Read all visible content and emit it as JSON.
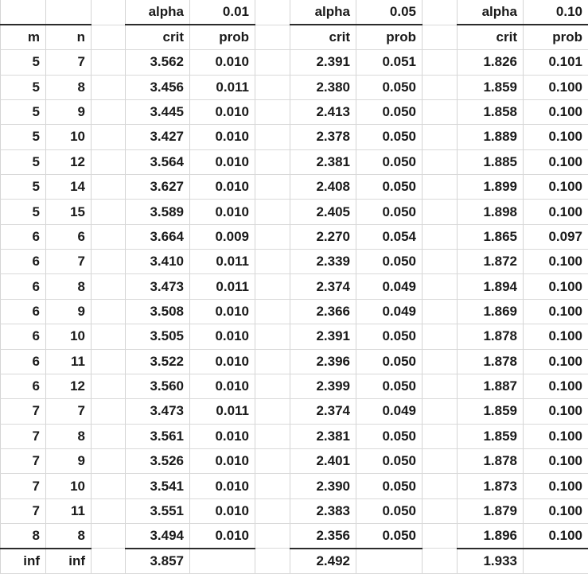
{
  "table": {
    "columns": {
      "m_label": "m",
      "n_label": "n",
      "alpha_label": "alpha",
      "crit_label": "crit",
      "prob_label": "prob"
    },
    "alpha_groups": [
      {
        "alpha_label": "alpha",
        "alpha_value": "0.01",
        "crit_label": "crit",
        "prob_label": "prob"
      },
      {
        "alpha_label": "alpha",
        "alpha_value": "0.05",
        "crit_label": "crit",
        "prob_label": "prob"
      },
      {
        "alpha_label": "alpha",
        "alpha_value": "0.10",
        "crit_label": "crit",
        "prob_label": "prob"
      }
    ],
    "rows": [
      {
        "m": "5",
        "n": "7",
        "a01_crit": "3.562",
        "a01_prob": "0.010",
        "a05_crit": "2.391",
        "a05_prob": "0.051",
        "a10_crit": "1.826",
        "a10_prob": "0.101"
      },
      {
        "m": "5",
        "n": "8",
        "a01_crit": "3.456",
        "a01_prob": "0.011",
        "a05_crit": "2.380",
        "a05_prob": "0.050",
        "a10_crit": "1.859",
        "a10_prob": "0.100"
      },
      {
        "m": "5",
        "n": "9",
        "a01_crit": "3.445",
        "a01_prob": "0.010",
        "a05_crit": "2.413",
        "a05_prob": "0.050",
        "a10_crit": "1.858",
        "a10_prob": "0.100"
      },
      {
        "m": "5",
        "n": "10",
        "a01_crit": "3.427",
        "a01_prob": "0.010",
        "a05_crit": "2.378",
        "a05_prob": "0.050",
        "a10_crit": "1.889",
        "a10_prob": "0.100"
      },
      {
        "m": "5",
        "n": "12",
        "a01_crit": "3.564",
        "a01_prob": "0.010",
        "a05_crit": "2.381",
        "a05_prob": "0.050",
        "a10_crit": "1.885",
        "a10_prob": "0.100"
      },
      {
        "m": "5",
        "n": "14",
        "a01_crit": "3.627",
        "a01_prob": "0.010",
        "a05_crit": "2.408",
        "a05_prob": "0.050",
        "a10_crit": "1.899",
        "a10_prob": "0.100"
      },
      {
        "m": "5",
        "n": "15",
        "a01_crit": "3.589",
        "a01_prob": "0.010",
        "a05_crit": "2.405",
        "a05_prob": "0.050",
        "a10_crit": "1.898",
        "a10_prob": "0.100"
      },
      {
        "m": "6",
        "n": "6",
        "a01_crit": "3.664",
        "a01_prob": "0.009",
        "a05_crit": "2.270",
        "a05_prob": "0.054",
        "a10_crit": "1.865",
        "a10_prob": "0.097"
      },
      {
        "m": "6",
        "n": "7",
        "a01_crit": "3.410",
        "a01_prob": "0.011",
        "a05_crit": "2.339",
        "a05_prob": "0.050",
        "a10_crit": "1.872",
        "a10_prob": "0.100"
      },
      {
        "m": "6",
        "n": "8",
        "a01_crit": "3.473",
        "a01_prob": "0.011",
        "a05_crit": "2.374",
        "a05_prob": "0.049",
        "a10_crit": "1.894",
        "a10_prob": "0.100"
      },
      {
        "m": "6",
        "n": "9",
        "a01_crit": "3.508",
        "a01_prob": "0.010",
        "a05_crit": "2.366",
        "a05_prob": "0.049",
        "a10_crit": "1.869",
        "a10_prob": "0.100"
      },
      {
        "m": "6",
        "n": "10",
        "a01_crit": "3.505",
        "a01_prob": "0.010",
        "a05_crit": "2.391",
        "a05_prob": "0.050",
        "a10_crit": "1.878",
        "a10_prob": "0.100"
      },
      {
        "m": "6",
        "n": "11",
        "a01_crit": "3.522",
        "a01_prob": "0.010",
        "a05_crit": "2.396",
        "a05_prob": "0.050",
        "a10_crit": "1.878",
        "a10_prob": "0.100"
      },
      {
        "m": "6",
        "n": "12",
        "a01_crit": "3.560",
        "a01_prob": "0.010",
        "a05_crit": "2.399",
        "a05_prob": "0.050",
        "a10_crit": "1.887",
        "a10_prob": "0.100"
      },
      {
        "m": "7",
        "n": "7",
        "a01_crit": "3.473",
        "a01_prob": "0.011",
        "a05_crit": "2.374",
        "a05_prob": "0.049",
        "a10_crit": "1.859",
        "a10_prob": "0.100"
      },
      {
        "m": "7",
        "n": "8",
        "a01_crit": "3.561",
        "a01_prob": "0.010",
        "a05_crit": "2.381",
        "a05_prob": "0.050",
        "a10_crit": "1.859",
        "a10_prob": "0.100"
      },
      {
        "m": "7",
        "n": "9",
        "a01_crit": "3.526",
        "a01_prob": "0.010",
        "a05_crit": "2.401",
        "a05_prob": "0.050",
        "a10_crit": "1.878",
        "a10_prob": "0.100"
      },
      {
        "m": "7",
        "n": "10",
        "a01_crit": "3.541",
        "a01_prob": "0.010",
        "a05_crit": "2.390",
        "a05_prob": "0.050",
        "a10_crit": "1.873",
        "a10_prob": "0.100"
      },
      {
        "m": "7",
        "n": "11",
        "a01_crit": "3.551",
        "a01_prob": "0.010",
        "a05_crit": "2.383",
        "a05_prob": "0.050",
        "a10_crit": "1.879",
        "a10_prob": "0.100"
      },
      {
        "m": "8",
        "n": "8",
        "a01_crit": "3.494",
        "a01_prob": "0.010",
        "a05_crit": "2.356",
        "a05_prob": "0.050",
        "a10_crit": "1.896",
        "a10_prob": "0.100"
      }
    ],
    "inf_row": {
      "m": "inf",
      "n": "inf",
      "a01_crit": "3.857",
      "a01_prob": "",
      "a05_crit": "2.492",
      "a05_prob": "",
      "a10_crit": "1.933",
      "a10_prob": ""
    }
  }
}
